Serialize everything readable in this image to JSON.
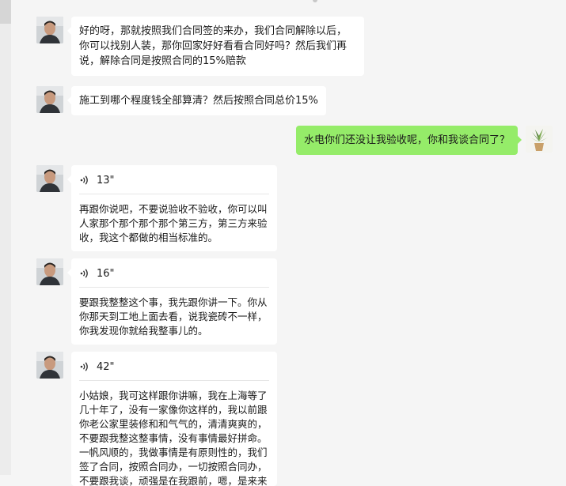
{
  "messages": [
    {
      "sender": "contact",
      "type": "text",
      "text": "好的呀，那就按照我们合同签的来办，我们合同解除以后，你可以找别人装，那你回家好好看看合同好吗？然后我们再说，解除合同是按照合同的15%赔款"
    },
    {
      "sender": "contact",
      "type": "text",
      "text": "施工到哪个程度钱全部算清？然后按照合同总价15%"
    },
    {
      "sender": "me",
      "type": "text",
      "text": "水电你们还没让我验收呢，你和我谈合同了？"
    },
    {
      "sender": "contact",
      "type": "voice",
      "duration": "13\"",
      "transcript": "再跟你说吧，不要说验收不验收，你可以叫人家那个那个那个那个第三方，第三方来验收，我这个都做的相当标准的。"
    },
    {
      "sender": "contact",
      "type": "voice",
      "duration": "16\"",
      "transcript": "要跟我整整这个事，我先跟你讲一下。你从你那天到工地上面去看，说我瓷砖不一样，你我发现你就给我整事儿的。"
    },
    {
      "sender": "contact",
      "type": "voice",
      "duration": "42\"",
      "transcript": "小姑娘，我可这样跟你讲嘛，我在上海等了几十年了，没有一家像你这样的，我以前跟你老公家里装修和和气气的，清清爽爽的，不要跟我整这整事情，没有事情最好拼命。一帆风顺的，我做事情是有原则性的，我们签了合同，按照合同办，一切按照合同办，不要跟我谈，顽强是在我跟前，嗯，是来来来来，找来找我"
    }
  ],
  "colors": {
    "background": "#f5f5f5",
    "sent_bubble": "#95ec69",
    "received_bubble": "#ffffff"
  },
  "icons": {
    "voice": "voice-wave-icon"
  }
}
